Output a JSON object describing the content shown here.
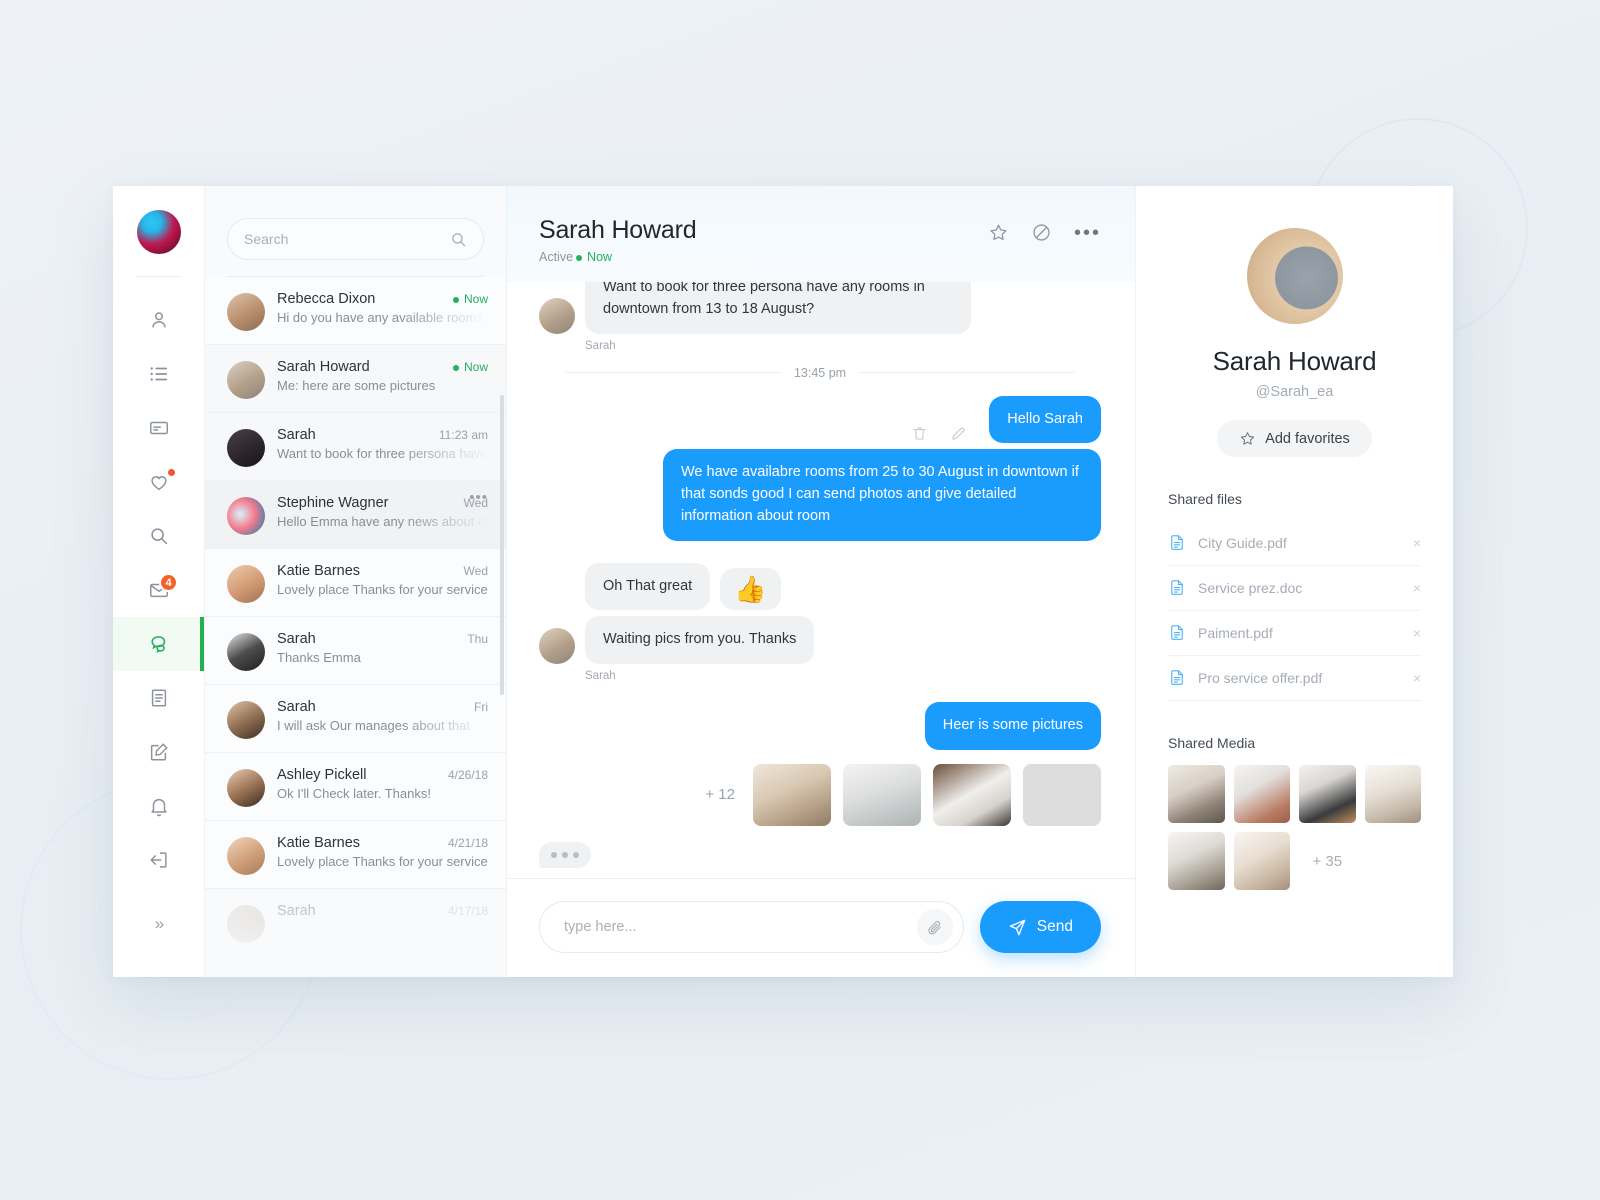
{
  "rail": {
    "items": [
      {
        "name": "profile",
        "icon": "person-icon"
      },
      {
        "name": "lists",
        "icon": "list-icon"
      },
      {
        "name": "cards",
        "icon": "card-icon"
      },
      {
        "name": "favorites",
        "icon": "heart-icon",
        "dot": true
      },
      {
        "name": "search",
        "icon": "search-icon"
      },
      {
        "name": "mail",
        "icon": "mail-icon",
        "badge": "4"
      },
      {
        "name": "messages",
        "icon": "chat-icon",
        "active": true
      },
      {
        "name": "documents",
        "icon": "document-icon"
      },
      {
        "name": "compose",
        "icon": "compose-icon"
      },
      {
        "name": "notifications",
        "icon": "bell-icon"
      },
      {
        "name": "logout",
        "icon": "logout-icon"
      }
    ],
    "expand_label": "»"
  },
  "search": {
    "placeholder": "Search",
    "value": ""
  },
  "conversations": [
    {
      "name": "Rebecca Dixon",
      "preview": "Hi do you have any available rooms for",
      "meta": "Now",
      "online": true
    },
    {
      "name": "Sarah Howard",
      "preview": "Me: here are some pictures",
      "meta": "Now",
      "online": true
    },
    {
      "name": "Sarah",
      "preview": "Want to book for three persona have a",
      "meta": "11:23 am",
      "online": false
    },
    {
      "name": "Stephine Wagner",
      "preview": "Hello Emma have any news about our",
      "meta": "Wed",
      "online": false,
      "highlighted": true,
      "menu": "•••"
    },
    {
      "name": "Katie Barnes",
      "preview": "Lovely place Thanks for your service",
      "meta": "Wed",
      "online": false
    },
    {
      "name": "Sarah",
      "preview": "Thanks  Emma",
      "meta": "Thu",
      "online": false
    },
    {
      "name": "Sarah",
      "preview": "I will ask Our manages about that",
      "meta": "Fri",
      "online": false
    },
    {
      "name": "Ashley Pickell",
      "preview": "Ok I'll Check later. Thanks!",
      "meta": "4/26/18",
      "online": false
    },
    {
      "name": "Katie Barnes",
      "preview": "Lovely place Thanks for your service",
      "meta": "4/21/18",
      "online": false
    },
    {
      "name": "Sarah",
      "preview": "",
      "meta": "4/17/18",
      "online": false,
      "faded": true
    }
  ],
  "header": {
    "title": "Sarah Howard",
    "status_prefix": "Active",
    "status": "Now",
    "star_icon": "star-icon",
    "block_icon": "block-icon",
    "more_icon": "•••"
  },
  "messages": {
    "incoming_first": "Want to book for three persona have any rooms in downtown from 13 to 18 August?",
    "incoming_first_sender": "Sarah",
    "timestamp": "13:45 pm",
    "hello": "Hello Sarah",
    "offer": "We have availabre rooms from 25  to 30 August in downtown if that sonds good I can send photos and give detailed information about room",
    "great": "Oh That great",
    "emoji": "👍",
    "waiting": "Waiting pics from you. Thanks",
    "waiting_sender": "Sarah",
    "pictures": "Heer is some pictures",
    "thumbs_overflow": "+ 12"
  },
  "composer": {
    "placeholder": "type here...",
    "value": "",
    "attach_icon": "paperclip-icon",
    "send_label": "Send",
    "send_icon": "send-icon"
  },
  "profile": {
    "name": "Sarah Howard",
    "handle": "@Sarah_ea",
    "favorite_label": "Add favorites",
    "favorite_icon": "star-icon",
    "files_title": "Shared files",
    "files": [
      {
        "name": "City Guide.pdf",
        "close": "×"
      },
      {
        "name": "Service prez.doc",
        "close": "×"
      },
      {
        "name": "Paiment.pdf",
        "close": "×"
      },
      {
        "name": "Pro service offer.pdf",
        "close": "×"
      }
    ],
    "media_title": "Shared Media",
    "media_overflow": "+ 35"
  },
  "colors": {
    "accent_blue": "#1a9cfc",
    "online_green": "#27ae60",
    "badge_orange": "#f4622a",
    "page_bg": "#eaf0f4"
  }
}
